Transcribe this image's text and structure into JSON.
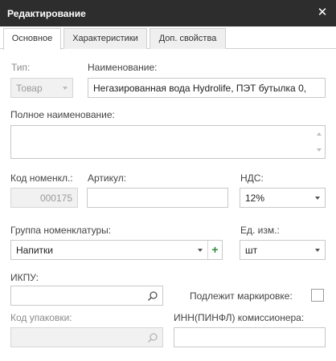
{
  "window": {
    "title": "Редактирование",
    "close_icon": "close-icon"
  },
  "tabs": [
    {
      "label": "Основное",
      "active": true
    },
    {
      "label": "Характеристики",
      "active": false
    },
    {
      "label": "Доп. свойства",
      "active": false
    }
  ],
  "form": {
    "type_label": "Тип:",
    "type_value": "Товар",
    "name_label": "Наименование:",
    "name_value": "Негазированная вода Hydrolife, ПЭТ бутылка 0,",
    "full_name_label": "Полное наименование:",
    "full_name_value": "",
    "code_label": "Код номенкл.:",
    "code_value": "000175",
    "article_label": "Артикул:",
    "article_value": "",
    "vat_label": "НДС:",
    "vat_value": "12%",
    "group_label": "Группа номенклатуры:",
    "group_value": "Напитки",
    "group_add_symbol": "+",
    "unit_label": "Ед. изм.:",
    "unit_value": "шт",
    "ikpu_label": "ИКПУ:",
    "ikpu_value": "",
    "marking_label": "Подлежит маркировке:",
    "marking_checked": false,
    "package_code_label": "Код упаковки:",
    "package_code_value": "",
    "inn_label": "ИНН(ПИНФЛ) комиссионера:",
    "inn_value": ""
  },
  "colors": {
    "titlebar_bg": "#2d2d2d",
    "add_green": "#2f8a3b",
    "disabled_bg": "#f1f1f1"
  }
}
